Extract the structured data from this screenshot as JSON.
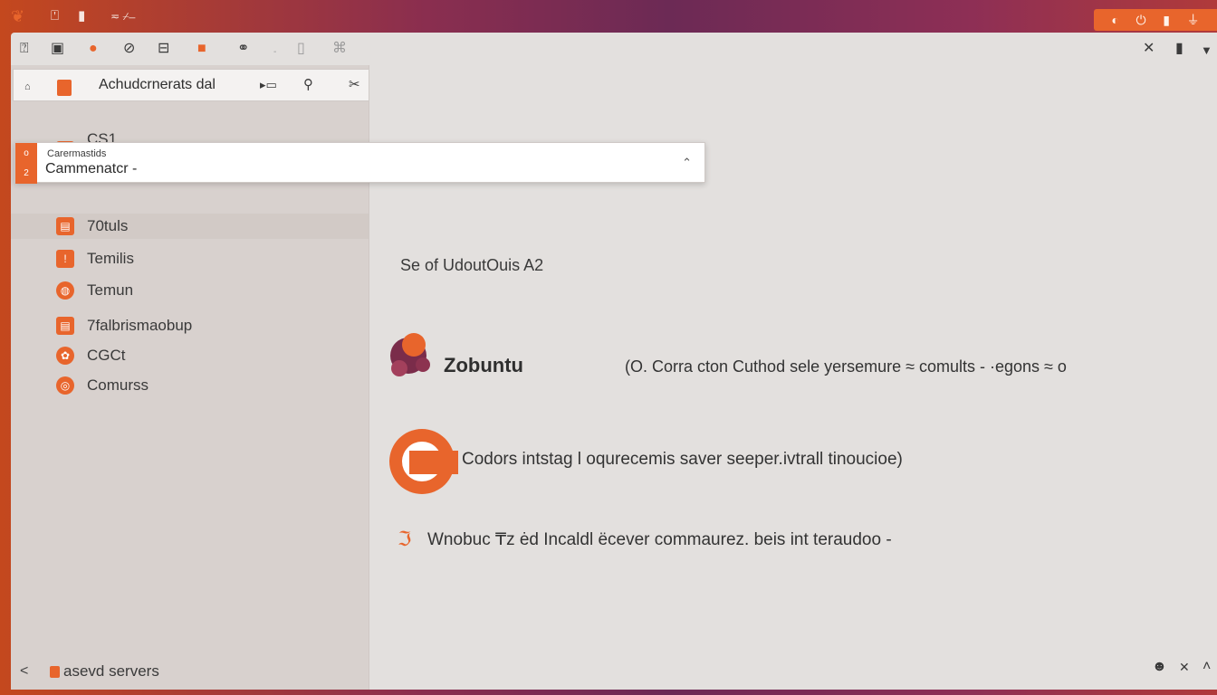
{
  "topbar": {
    "tray_icons": [
      "shield-icon",
      "power-icon",
      "battery-icon",
      "network-icon"
    ],
    "tray_glyphs": [
      "◐",
      "⏻",
      "▮",
      "⏚"
    ]
  },
  "window": {
    "close_glyph": "✕",
    "pin_glyph": "▮",
    "menu_glyph": "▼"
  },
  "sidebar": {
    "header_title": "Achudcrnerats dal",
    "items": [
      {
        "label": "CS1",
        "icon": "app-icon"
      },
      {
        "label": "70tuls",
        "icon": "app-icon"
      },
      {
        "label": "Temilis",
        "icon": "terminal-icon"
      },
      {
        "label": "Temun",
        "icon": "terminal-icon"
      },
      {
        "label": "7falbrismaobup",
        "icon": "package-icon"
      },
      {
        "label": "CGCt",
        "icon": "app-icon"
      },
      {
        "label": "Comurss",
        "icon": "app-icon"
      }
    ],
    "footer_label": "asevd servers",
    "footer_back_glyph": "<"
  },
  "popup": {
    "small_text": "Carermastids",
    "main_text": "Cammenatcr -",
    "strip_top": "o",
    "strip_bottom": "2"
  },
  "main": {
    "subtitle": "Se of UdoutOuis A2",
    "brand": "Zobuntu",
    "description": "(O. Corra cton Cuthod sele yersemure ≈ comults - ·egons ≈ o",
    "line2": "Codors intstag l oqurecemis saver seeper.ivtrall tinoucioe)",
    "line3": "Wnobuc ₸z ėd Incaldl ëcever commaurez. beis int teraudoo -"
  },
  "bottom_right": {
    "glyphs": [
      "☻",
      "✕",
      "˄"
    ]
  },
  "colors": {
    "accent": "#e8652c",
    "aubergine": "#6c2a55",
    "window_bg": "#e3e0de",
    "sidebar_bg": "#d8d1ce"
  }
}
